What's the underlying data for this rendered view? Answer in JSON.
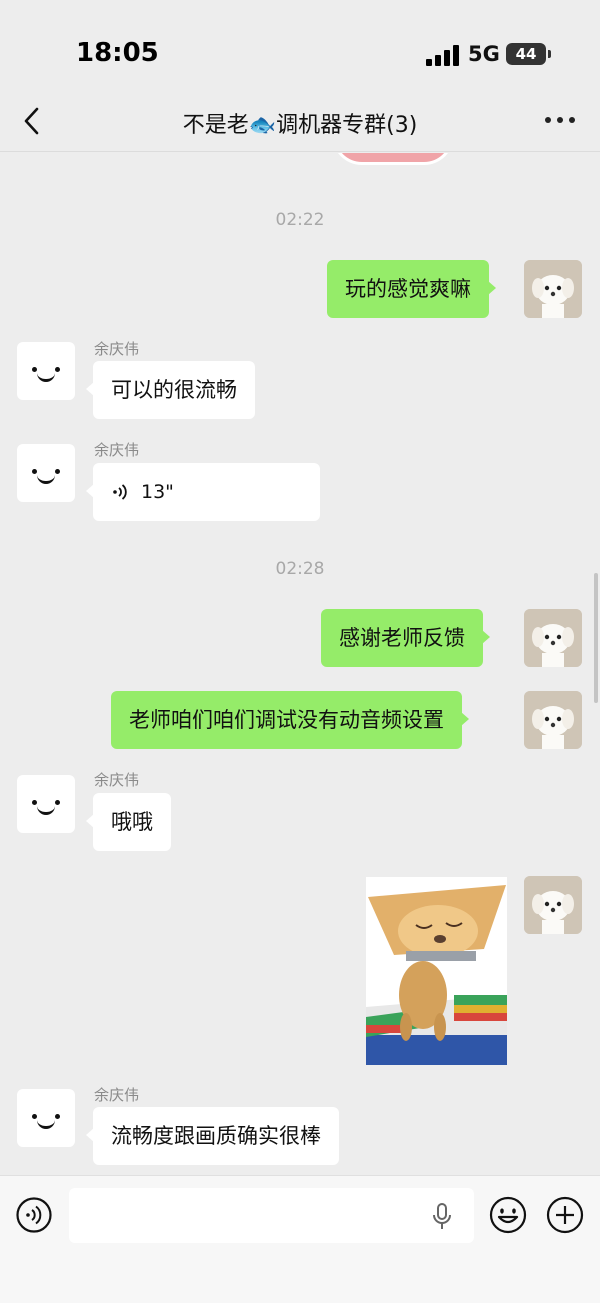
{
  "status_bar": {
    "time": "18:05",
    "network": "5G",
    "battery": "44"
  },
  "header": {
    "title": "不是老🐟调机器专群(3)",
    "back_icon": "chevron-left-icon",
    "more_icon": "ellipsis-icon"
  },
  "messages": {
    "ts1": "02:22",
    "m1": "玩的感觉爽嘛",
    "m2_sender": "余庆伟",
    "m2": "可以的很流畅",
    "m3_sender": "余庆伟",
    "m3_duration": "13\"",
    "ts2": "02:28",
    "m4": "感谢老师反馈",
    "m5": "老师咱们咱们调试没有动音频设置",
    "m6_sender": "余庆伟",
    "m6": "哦哦",
    "m8_sender": "余庆伟",
    "m8": "流畅度跟画质确实很棒"
  },
  "input_bar": {
    "placeholder": "",
    "voice_icon": "voice-toggle-icon",
    "mic_icon": "microphone-icon",
    "emoji_icon": "emoji-icon",
    "plus_icon": "plus-icon"
  },
  "colors": {
    "outgoing_bubble": "#95ec69",
    "incoming_bubble": "#ffffff",
    "background": "#ededed"
  }
}
